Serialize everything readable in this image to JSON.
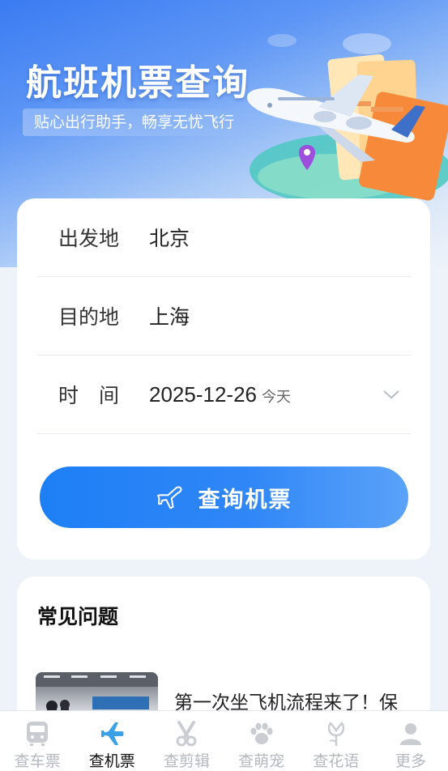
{
  "hero": {
    "title": "航班机票查询",
    "subtitle": "贴心出行助手，畅享无忧飞行"
  },
  "form": {
    "departure": {
      "label": "出发地",
      "value": "北京"
    },
    "destination": {
      "label": "目的地",
      "value": "上海"
    },
    "date": {
      "label": "时　间",
      "value": "2025-12-26",
      "note": "今天"
    },
    "search_label": "查询机票"
  },
  "faq": {
    "title": "常见问题",
    "items": [
      {
        "text": "第一次坐飞机流程来了！保"
      }
    ]
  },
  "tabbar": {
    "items": [
      {
        "label": "查车票",
        "icon": "train-icon",
        "active": false
      },
      {
        "label": "查机票",
        "icon": "plane-icon",
        "active": true
      },
      {
        "label": "查剪辑",
        "icon": "scissors-icon",
        "active": false
      },
      {
        "label": "查萌宠",
        "icon": "paw-icon",
        "active": false
      },
      {
        "label": "查花语",
        "icon": "flower-icon",
        "active": false
      },
      {
        "label": "更多",
        "icon": "user-icon",
        "active": false
      }
    ]
  },
  "colors": {
    "accent": "#1e7ff5",
    "active_tab_icon": "#3aa0e8",
    "inactive": "#b4b8be"
  }
}
